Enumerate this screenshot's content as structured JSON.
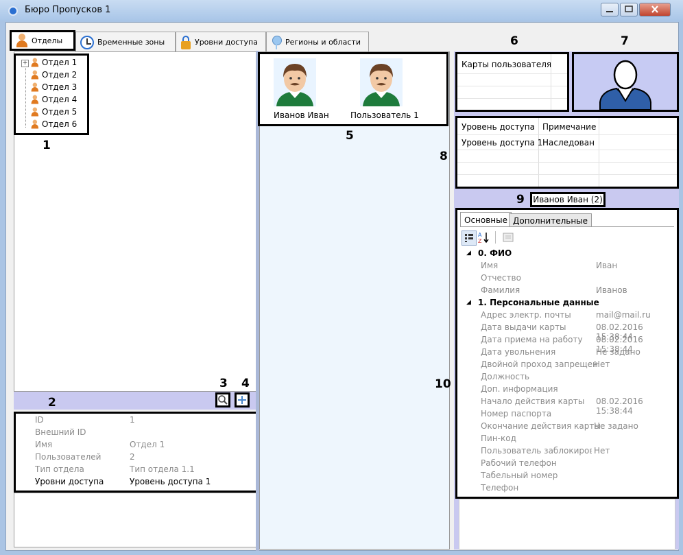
{
  "window": {
    "title": "Бюро Пропусков 1"
  },
  "tabs": [
    {
      "label": "Отделы",
      "icon": "person-icon"
    },
    {
      "label": "Временные зоны",
      "icon": "clock-icon"
    },
    {
      "label": "Уровни доступа",
      "icon": "lock-icon"
    },
    {
      "label": "Регионы и области",
      "icon": "pin-icon"
    }
  ],
  "tree": {
    "items": [
      "Отдел 1",
      "Отдел 2",
      "Отдел 3",
      "Отдел 4",
      "Отдел 5",
      "Отдел 6"
    ],
    "expander": "+"
  },
  "callouts": {
    "n1": "1",
    "n2": "2",
    "n3": "3",
    "n4": "4",
    "n5": "5",
    "n6": "6",
    "n7": "7",
    "n8": "8",
    "n9": "9",
    "n10": "10"
  },
  "department_details": [
    {
      "label": "ID",
      "value": "1"
    },
    {
      "label": "Внешний ID",
      "value": ""
    },
    {
      "label": "Имя",
      "value": "Отдел 1"
    },
    {
      "label": "Пользователей",
      "value": "2"
    },
    {
      "label": "Тип отдела",
      "value": "Тип отдела 1.1"
    },
    {
      "label": "Уровни доступа",
      "value": "Уровень доступа 1"
    }
  ],
  "users": [
    "Иванов Иван",
    "Пользователь 1"
  ],
  "cards": {
    "header": "Карты пользователя"
  },
  "access_levels": {
    "headers": [
      "Уровень доступа",
      "Примечание"
    ],
    "rows": [
      [
        "Уровень доступа 1",
        "Наследован"
      ]
    ]
  },
  "selected_user": "Иванов Иван (2)",
  "props_tabs": [
    "Основные",
    "Дополнительные"
  ],
  "properties": {
    "cat0": "0. ФИО",
    "fio": [
      {
        "label": "Имя",
        "value": "Иван"
      },
      {
        "label": "Отчество",
        "value": ""
      },
      {
        "label": "Фамилия",
        "value": "Иванов"
      }
    ],
    "cat1": "1. Персональные данные",
    "personal": [
      {
        "label": "Адрес электр. почты",
        "value": "mail@mail.ru"
      },
      {
        "label": "Дата выдачи карты",
        "value": "08.02.2016 15:38:44"
      },
      {
        "label": "Дата приема на работу",
        "value": "08.02.2016 15:38:44"
      },
      {
        "label": "Дата увольнения",
        "value": "Не задано"
      },
      {
        "label": "Двойной проход запрещен",
        "value": "Нет"
      },
      {
        "label": "Должность",
        "value": ""
      },
      {
        "label": "Доп. информация",
        "value": ""
      },
      {
        "label": "Начало действия карты",
        "value": "08.02.2016 15:38:44"
      },
      {
        "label": "Номер паспорта",
        "value": ""
      },
      {
        "label": "Окончание действия карты",
        "value": "Не задано"
      },
      {
        "label": "Пин-код",
        "value": ""
      },
      {
        "label": "Пользователь заблокирован",
        "value": "Нет"
      },
      {
        "label": "Рабочий телефон",
        "value": ""
      },
      {
        "label": "Табельный номер",
        "value": ""
      },
      {
        "label": "Телефон",
        "value": ""
      }
    ]
  },
  "colors": {
    "accent": "#c9c9f0",
    "photo_bg": "#c7cbf3",
    "person_shirt": "#1e7b3c",
    "hair": "#6b4226"
  }
}
